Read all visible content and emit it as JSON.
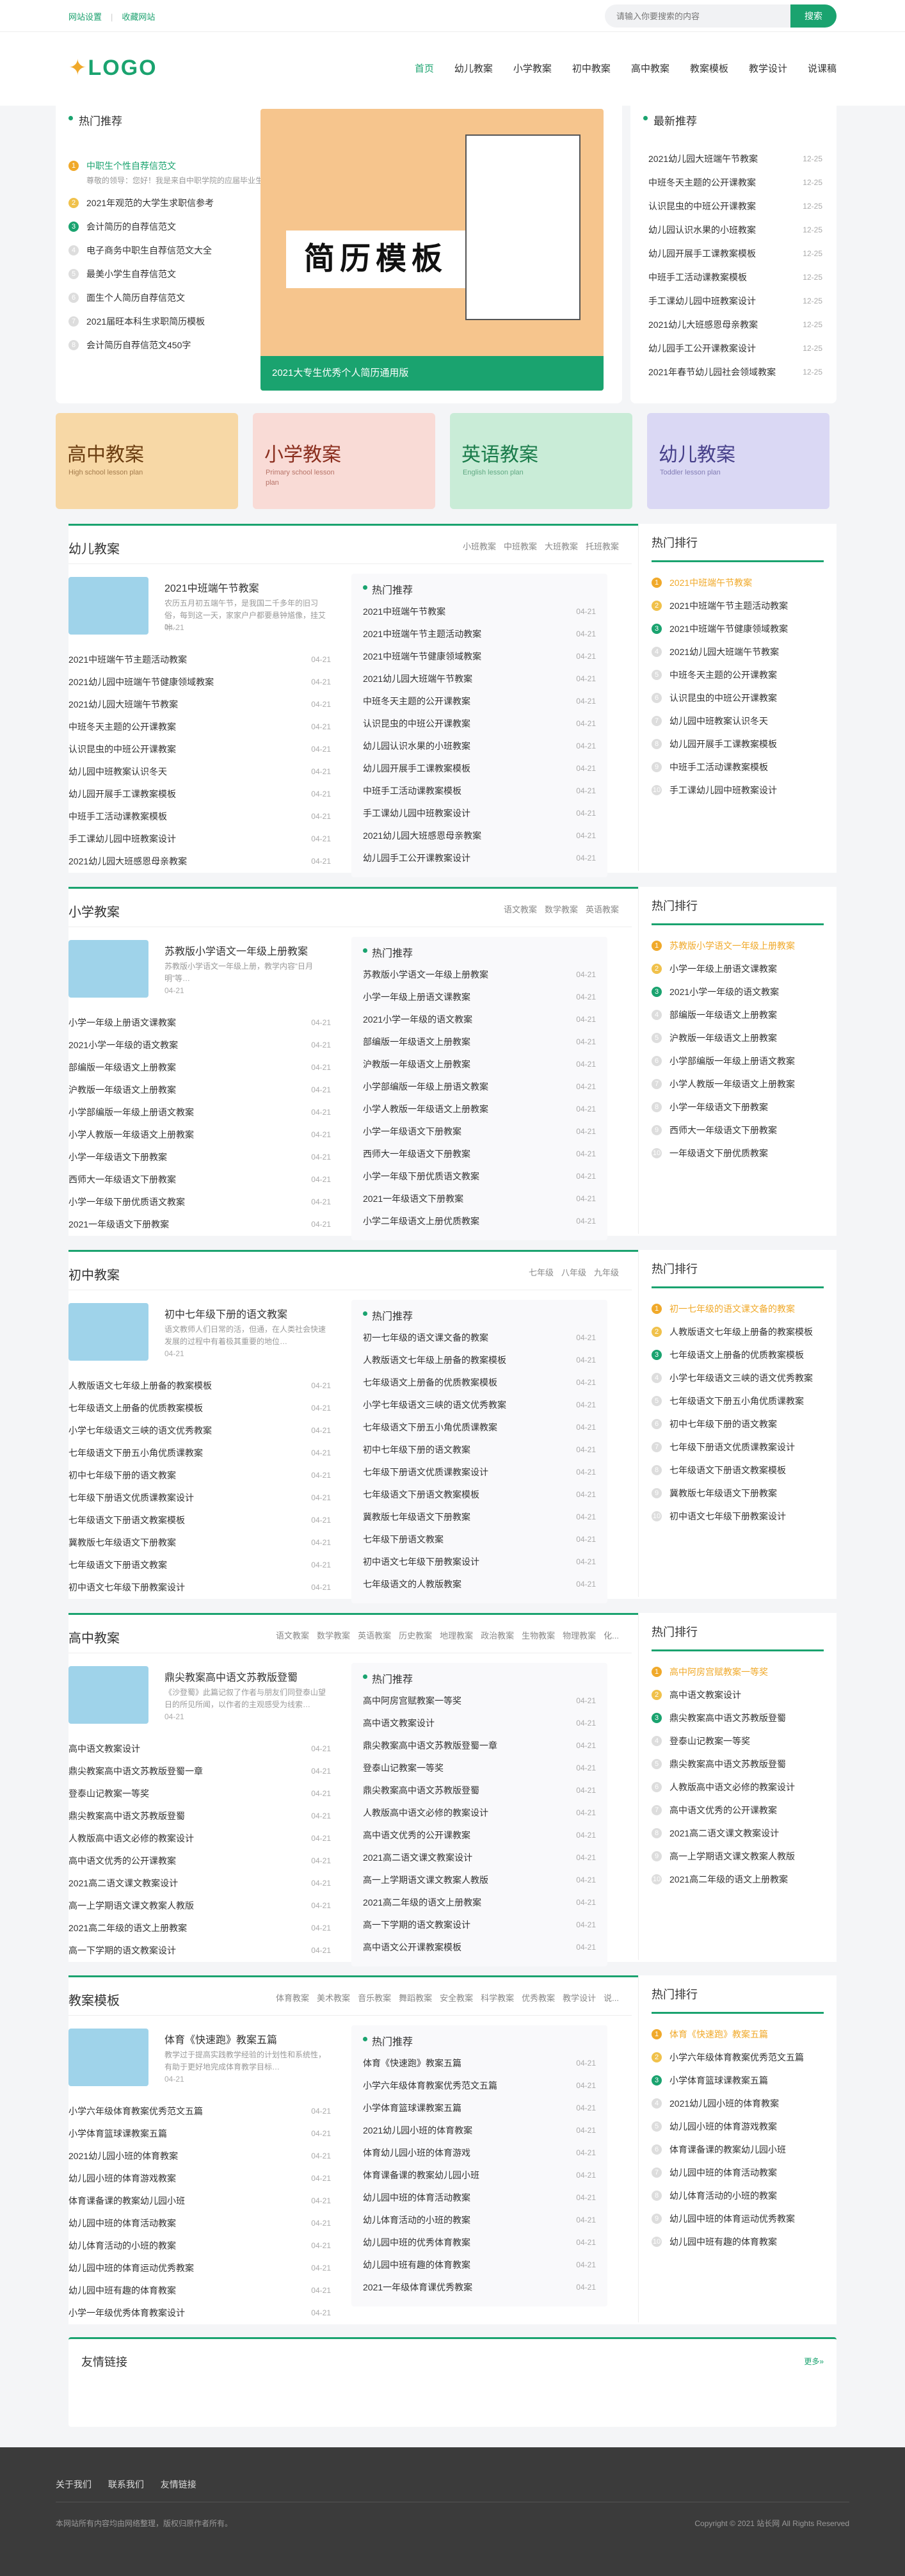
{
  "topbar": {
    "links": [
      "网站设置",
      "收藏网站"
    ],
    "search_placeholder": "请输入你要搜索的内容",
    "search_button": "搜索"
  },
  "logo": {
    "text": "LOGO"
  },
  "nav": [
    "首页",
    "幼儿教案",
    "小学教案",
    "初中教案",
    "高中教案",
    "教案模板",
    "教学设计",
    "说课稿"
  ],
  "hot_recommend": {
    "title": "热门推荐",
    "items": [
      {
        "n": "1",
        "title": "中职生个性自荐信范文",
        "desc": "尊敬的领导：您好！我是来自中职学院的应届毕业生…"
      },
      {
        "n": "2",
        "title": "2021年观范的大学生求职信参考"
      },
      {
        "n": "3",
        "title": "会计简历的自荐信范文"
      },
      {
        "n": "4",
        "title": "电子商务中职生自荐信范文大全"
      },
      {
        "n": "5",
        "title": "最美小学生自荐信范文"
      },
      {
        "n": "6",
        "title": "面生个人简历自荐信范文"
      },
      {
        "n": "7",
        "title": "2021届旺本科生求职简历模板"
      },
      {
        "n": "8",
        "title": "会计简历自荐信范文450字"
      }
    ]
  },
  "banner": {
    "big": "简历模板",
    "caption": "2021大专生优秀个人简历通用版"
  },
  "latest": {
    "title": "最新推荐",
    "items": [
      {
        "t": "2021幼儿园大班端午节教案",
        "d": "12-25"
      },
      {
        "t": "中班冬天主题的公开课教案",
        "d": "12-25"
      },
      {
        "t": "认识昆虫的中班公开课教案",
        "d": "12-25"
      },
      {
        "t": "幼儿园认识水果的小班教案",
        "d": "12-25"
      },
      {
        "t": "幼儿园开展手工课教案模板",
        "d": "12-25"
      },
      {
        "t": "中班手工活动课教案模板",
        "d": "12-25"
      },
      {
        "t": "手工课幼儿园中班教案设计",
        "d": "12-25"
      },
      {
        "t": "2021幼儿大班感恩母亲教案",
        "d": "12-25"
      },
      {
        "t": "幼儿园手工公开课教案设计",
        "d": "12-25"
      },
      {
        "t": "2021年春节幼儿园社会领域教案",
        "d": "12-25"
      }
    ]
  },
  "categories": [
    {
      "t": "高中教案",
      "e": "High school lesson plan",
      "color": "#f7d8a6",
      "tc": "#6b3d10"
    },
    {
      "t": "小学教案",
      "e": "Primary school lesson plan",
      "color": "#f9dbd6",
      "tc": "#8a2e1e"
    },
    {
      "t": "英语教案",
      "e": "English lesson plan",
      "color": "#c9ecd7",
      "tc": "#1a7b4a"
    },
    {
      "t": "幼儿教案",
      "e": "Toddler lesson plan",
      "color": "#dad8f4",
      "tc": "#47408a"
    }
  ],
  "sections": [
    {
      "name": "幼儿教案",
      "tags": [
        "小班教案",
        "中班教案",
        "大班教案",
        "托班教案"
      ],
      "feat": {
        "title": "2021中班端午节教案",
        "desc": "农历五月初五端午节，是我国二千多年的旧习俗，每到这一天，家家户户都要悬钟馗像，挂艾叶…",
        "date": "04-21"
      },
      "list": [
        "2021中班端午节主题活动教案",
        "2021幼儿园中班端午节健康领域教案",
        "2021幼儿园大班端午节教案",
        "中班冬天主题的公开课教案",
        "认识昆虫的中班公开课教案",
        "幼儿园中班教案认识冬天",
        "幼儿园开展手工课教案模板",
        "中班手工活动课教案模板",
        "手工课幼儿园中班教案设计",
        "2021幼儿园大班感恩母亲教案"
      ],
      "hot": [
        "2021中班端午节教案",
        "2021中班端午节主题活动教案",
        "2021中班端午节健康领域教案",
        "2021幼儿园大班端午节教案",
        "中班冬天主题的公开课教案",
        "认识昆虫的中班公开课教案",
        "幼儿园认识水果的小班教案",
        "幼儿园开展手工课教案模板",
        "中班手工活动课教案模板",
        "手工课幼儿园中班教案设计",
        "2021幼儿园大班感恩母亲教案",
        "幼儿园手工公开课教案设计"
      ],
      "rank": [
        "2021中班端午节教案",
        "2021中班端午节主题活动教案",
        "2021中班端午节健康领域教案",
        "2021幼儿园大班端午节教案",
        "中班冬天主题的公开课教案",
        "认识昆虫的中班公开课教案",
        "幼儿园中班教案认识冬天",
        "幼儿园开展手工课教案模板",
        "中班手工活动课教案模板",
        "手工课幼儿园中班教案设计"
      ]
    },
    {
      "name": "小学教案",
      "tags": [
        "语文教案",
        "数学教案",
        "英语教案"
      ],
      "feat": {
        "title": "苏教版小学语文一年级上册教案",
        "desc": "苏教版小学语文一年级上册，教学内容“日月明”等…",
        "date": "04-21"
      },
      "list": [
        "小学一年级上册语文课教案",
        "2021小学一年级的语文教案",
        "部编版一年级语文上册教案",
        "沪教版一年级语文上册教案",
        "小学部编版一年级上册语文教案",
        "小学人教版一年级语文上册教案",
        "小学一年级语文下册教案",
        "西师大一年级语文下册教案",
        "小学一年级下册优质语文教案",
        "2021一年级语文下册教案"
      ],
      "hot": [
        "苏教版小学语文一年级上册教案",
        "小学一年级上册语文课教案",
        "2021小学一年级的语文教案",
        "部编版一年级语文上册教案",
        "沪教版一年级语文上册教案",
        "小学部编版一年级上册语文教案",
        "小学人教版一年级语文上册教案",
        "小学一年级语文下册教案",
        "西师大一年级语文下册教案",
        "小学一年级下册优质语文教案",
        "2021一年级语文下册教案",
        "小学二年级语文上册优质教案"
      ],
      "rank": [
        "苏教版小学语文一年级上册教案",
        "小学一年级上册语文课教案",
        "2021小学一年级的语文教案",
        "部编版一年级语文上册教案",
        "沪教版一年级语文上册教案",
        "小学部编版一年级上册语文教案",
        "小学人教版一年级语文上册教案",
        "小学一年级语文下册教案",
        "西师大一年级语文下册教案",
        "一年级语文下册优质教案"
      ]
    },
    {
      "name": "初中教案",
      "tags": [
        "七年级",
        "八年级",
        "九年级"
      ],
      "feat": {
        "title": "初中七年级下册的语文教案",
        "desc": "语文教师人们日常的活，但通，在人类社会快速发展的过程中有着极其重要的地位…",
        "date": "04-21"
      },
      "list": [
        "人教版语文七年级上册备的教案模板",
        "七年级语文上册备的优质教案模板",
        "小学七年级语文三峡的语文优秀教案",
        "七年级语文下册五小角优质课教案",
        "初中七年级下册的语文教案",
        "七年级下册语文优质课教案设计",
        "七年级语文下册语文教案模板",
        "冀教版七年级语文下册教案",
        "七年级语文下册语文教案",
        "初中语文七年级下册教案设计"
      ],
      "hot": [
        "初一七年级的语文课文备的教案",
        "人教版语文七年级上册备的教案模板",
        "七年级语文上册备的优质教案模板",
        "小学七年级语文三峡的语文优秀教案",
        "七年级语文下册五小角优质课教案",
        "初中七年级下册的语文教案",
        "七年级下册语文优质课教案设计",
        "七年级语文下册语文教案模板",
        "冀教版七年级语文下册教案",
        "七年级下册语文教案",
        "初中语文七年级下册教案设计",
        "七年级语文的人教版教案"
      ],
      "rank": [
        "初一七年级的语文课文备的教案",
        "人教版语文七年级上册备的教案模板",
        "七年级语文上册备的优质教案模板",
        "小学七年级语文三峡的语文优秀教案",
        "七年级语文下册五小角优质课教案",
        "初中七年级下册的语文教案",
        "七年级下册语文优质课教案设计",
        "七年级语文下册语文教案模板",
        "冀教版七年级语文下册教案",
        "初中语文七年级下册教案设计"
      ]
    },
    {
      "name": "高中教案",
      "tags": [
        "语文教案",
        "数学教案",
        "英语教案",
        "历史教案",
        "地理教案",
        "政治教案",
        "生物教案",
        "物理教案",
        "化..."
      ],
      "feat": {
        "title": "鼎尖教案高中语文苏教版登蜀",
        "desc": "《沙登蜀》此篇记叙了作者与朋友们同登泰山望日的所见所闻，以作者的主观感受为线索…",
        "date": "04-21"
      },
      "list": [
        "高中语文教案设计",
        "鼎尖教案高中语文苏教版登蜀一章",
        "登泰山记教案一等奖",
        "鼎尖教案高中语文苏教版登蜀",
        "人教版高中语文必修的教案设计",
        "高中语文优秀的公开课教案",
        "2021高二语文课文教案设计",
        "高一上学期语文课文教案人教版",
        "2021高二年级的语文上册教案",
        "高一下学期的语文教案设计"
      ],
      "hot": [
        "高中阿房宫赋教案一等奖",
        "高中语文教案设计",
        "鼎尖教案高中语文苏教版登蜀一章",
        "登泰山记教案一等奖",
        "鼎尖教案高中语文苏教版登蜀",
        "人教版高中语文必修的教案设计",
        "高中语文优秀的公开课教案",
        "2021高二语文课文教案设计",
        "高一上学期语文课文教案人教版",
        "2021高二年级的语文上册教案",
        "高一下学期的语文教案设计",
        "高中语文公开课教案模板"
      ],
      "rank": [
        "高中阿房宫赋教案一等奖",
        "高中语文教案设计",
        "鼎尖教案高中语文苏教版登蜀",
        "登泰山记教案一等奖",
        "鼎尖教案高中语文苏教版登蜀",
        "人教版高中语文必修的教案设计",
        "高中语文优秀的公开课教案",
        "2021高二语文课文教案设计",
        "高一上学期语文课文教案人教版",
        "2021高二年级的语文上册教案"
      ]
    },
    {
      "name": "教案模板",
      "tags": [
        "体育教案",
        "美术教案",
        "音乐教案",
        "舞蹈教案",
        "安全教案",
        "科学教案",
        "优秀教案",
        "教学设计",
        "说..."
      ],
      "feat": {
        "title": "体育《快速跑》教案五篇",
        "desc": "教学过于提高实践教学经验的计划性和系统性，有助于更好地完成体育教学目标…",
        "date": "04-21"
      },
      "list": [
        "小学六年级体育教案优秀范文五篇",
        "小学体育篮球课教案五篇",
        "2021幼儿园小班的体育教案",
        "幼儿园小班的体育游戏教案",
        "体育课备课的教案幼儿园小班",
        "幼儿园中班的体育活动教案",
        "幼儿体育活动的小班的教案",
        "幼儿园中班的体育运动优秀教案",
        "幼儿园中班有趣的体育教案",
        "小学一年级优秀体育教案设计"
      ],
      "hot": [
        "体育《快速跑》教案五篇",
        "小学六年级体育教案优秀范文五篇",
        "小学体育篮球课教案五篇",
        "2021幼儿园小班的体育教案",
        "体育幼儿园小班的体育游戏",
        "体育课备课的教案幼儿园小班",
        "幼儿园中班的体育活动教案",
        "幼儿体育活动的小班的教案",
        "幼儿园中班的优秀体育教案",
        "幼儿园中班有趣的体育教案",
        "2021一年级体育课优秀教案"
      ],
      "rank": [
        "体育《快速跑》教案五篇",
        "小学六年级体育教案优秀范文五篇",
        "小学体育篮球课教案五篇",
        "2021幼儿园小班的体育教案",
        "幼儿园小班的体育游戏教案",
        "体育课备课的教案幼儿园小班",
        "幼儿园中班的体育活动教案",
        "幼儿体育活动的小班的教案",
        "幼儿园中班的体育运动优秀教案",
        "幼儿园中班有趣的体育教案"
      ]
    }
  ],
  "hot_section": "热门推荐",
  "rank_title": "热门排行",
  "date": "04-21",
  "friend_links": {
    "title": "友情链接",
    "more": "更多»"
  },
  "footer": {
    "links": [
      "关于我们",
      "联系我们",
      "友情链接"
    ],
    "note": "本网站所有内容均由网络整理，版权归原作者所有。",
    "copy": "Copyright © 2021 站长网 All Rights Reserved"
  }
}
